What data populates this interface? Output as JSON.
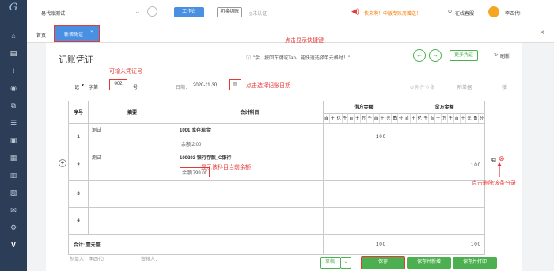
{
  "app": {
    "company": "易代账测试",
    "workbench": "工作台",
    "switch_account": "切换切账",
    "not_certified": "◎未认证",
    "promo": "快来啊！中版专账册赠送！",
    "service": "在线客服",
    "user": "李四代!"
  },
  "sidebar": {
    "icons": [
      "home-icon",
      "voucher-icon",
      "chart-icon",
      "coin-icon",
      "copy-icon",
      "list-icon",
      "box-icon",
      "ledger-icon",
      "doc-icon",
      "report-icon",
      "mail-icon",
      "gear-icon",
      "v-icon"
    ]
  },
  "tabs": {
    "home": "首页",
    "active": "新增凭证",
    "active_close": "×",
    "close_all": "×"
  },
  "page": {
    "title": "记账凭证",
    "hint": "\"余、按回车键或Tab、能快速选择单元格时！\"",
    "more": "更多凭证",
    "refresh": "刷新",
    "prev_icon": "←",
    "next_icon": "→"
  },
  "annotations": {
    "shortcut": "点击显示快捷键",
    "voucher_no_hint": "可输入凭证号",
    "date_hint": "点击选择记账日期",
    "balance_hint": "显示该科目当前余额",
    "delete_hint": "点击删除该条分录"
  },
  "form": {
    "word_label": "记",
    "word_value": "字第",
    "voucher_no": "002",
    "no_suffix": "号",
    "date_label": "日期：",
    "date_value": "2020-11-30",
    "attach_label": "附单据",
    "attach_suffix": "张",
    "right_hint": "⊘ 附件 0 张"
  },
  "table": {
    "headers": {
      "seq": "序号",
      "summary": "摘要",
      "account": "会计科目",
      "debit": "借方金额",
      "credit": "贷方金额"
    },
    "units": [
      "百",
      "十",
      "亿",
      "千",
      "百",
      "十",
      "万",
      "千",
      "百",
      "十",
      "元",
      "角",
      "分"
    ],
    "rows": [
      {
        "seq": "1",
        "summary": "测试",
        "account": "1001 库存现金",
        "balance": "余额:2.00",
        "debit": "100",
        "credit": ""
      },
      {
        "seq": "2",
        "summary": "测试",
        "account": "100203 银行存款_C银行",
        "balance": "余额:799.00",
        "debit": "",
        "credit": "100"
      },
      {
        "seq": "3",
        "summary": "",
        "account": "",
        "balance": "",
        "debit": "",
        "credit": ""
      },
      {
        "seq": "4",
        "summary": "",
        "account": "",
        "balance": "",
        "debit": "",
        "credit": ""
      }
    ],
    "total_label": "合计: 壹元整",
    "total_debit": "100",
    "total_credit": "100"
  },
  "footer": {
    "maker": "制单人：李四代!",
    "reviewer": "审核人：",
    "save_draft": "草稿",
    "save": "保存",
    "save_new": "保存并新增",
    "save_print": "保存并打印"
  }
}
